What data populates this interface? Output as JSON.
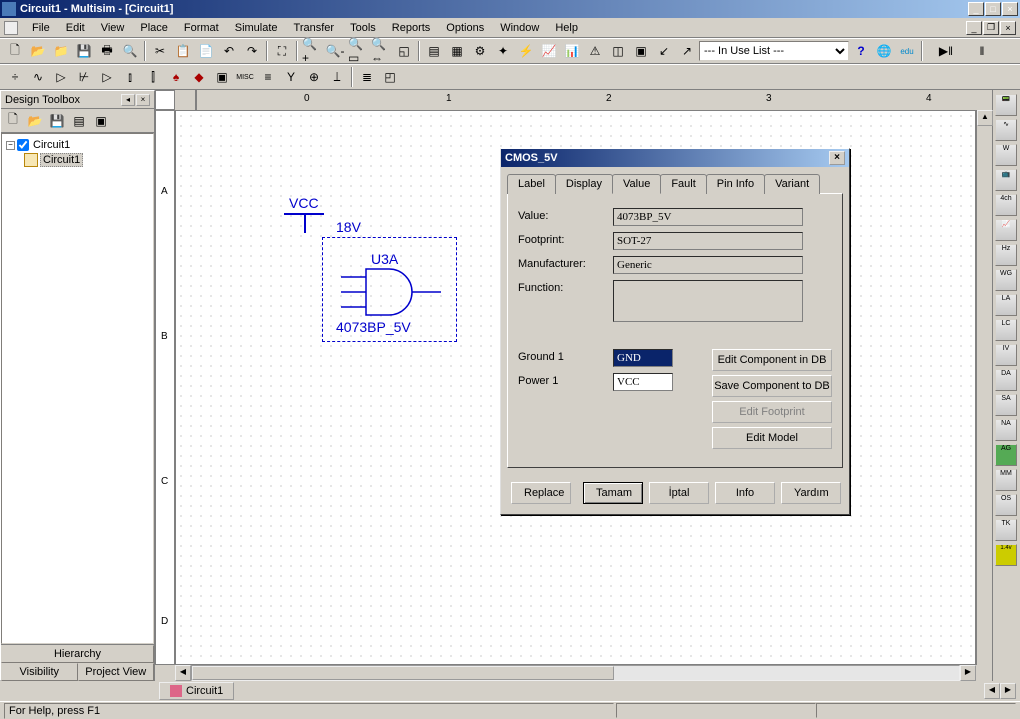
{
  "titlebar": {
    "title": "Circuit1 - Multisim - [Circuit1]"
  },
  "menu": [
    "File",
    "Edit",
    "View",
    "Place",
    "Format",
    "Simulate",
    "Transfer",
    "Tools",
    "Reports",
    "Options",
    "Window",
    "Help"
  ],
  "inUseList": "--- In Use List ---",
  "sidebar": {
    "title": "Design Toolbox",
    "root": "Circuit1",
    "child": "Circuit1",
    "tabHierarchy": "Hierarchy",
    "tabVisibility": "Visibility",
    "tabProjectView": "Project View"
  },
  "ruler": {
    "h": [
      "0",
      "1",
      "2",
      "3",
      "4"
    ],
    "v": [
      "A",
      "B",
      "C",
      "D"
    ]
  },
  "schematic": {
    "vcc": "VCC",
    "vccVal": "18V",
    "refdes": "U3A",
    "part": "4073BP_5V"
  },
  "docTab": "Circuit1",
  "statusbar": "For Help, press F1",
  "dialog": {
    "title": "CMOS_5V",
    "tabs": [
      "Label",
      "Display",
      "Value",
      "Fault",
      "Pin Info",
      "Variant"
    ],
    "valueLabel": "Value:",
    "valueField": "4073BP_5V",
    "footprintLabel": "Footprint:",
    "footprintField": "SOT-27",
    "manufacturerLabel": "Manufacturer:",
    "manufacturerField": "Generic",
    "functionLabel": "Function:",
    "functionField": "",
    "ground1Label": "Ground 1",
    "ground1Field": "GND",
    "power1Label": "Power 1",
    "power1Field": "VCC",
    "editInDb": "Edit Component in DB",
    "saveToDb": "Save Component to DB",
    "editFootprint": "Edit Footprint",
    "editModel": "Edit Model",
    "replace": "Replace",
    "ok": "Tamam",
    "cancel": "İptal",
    "info": "Info",
    "help": "Yardım"
  }
}
